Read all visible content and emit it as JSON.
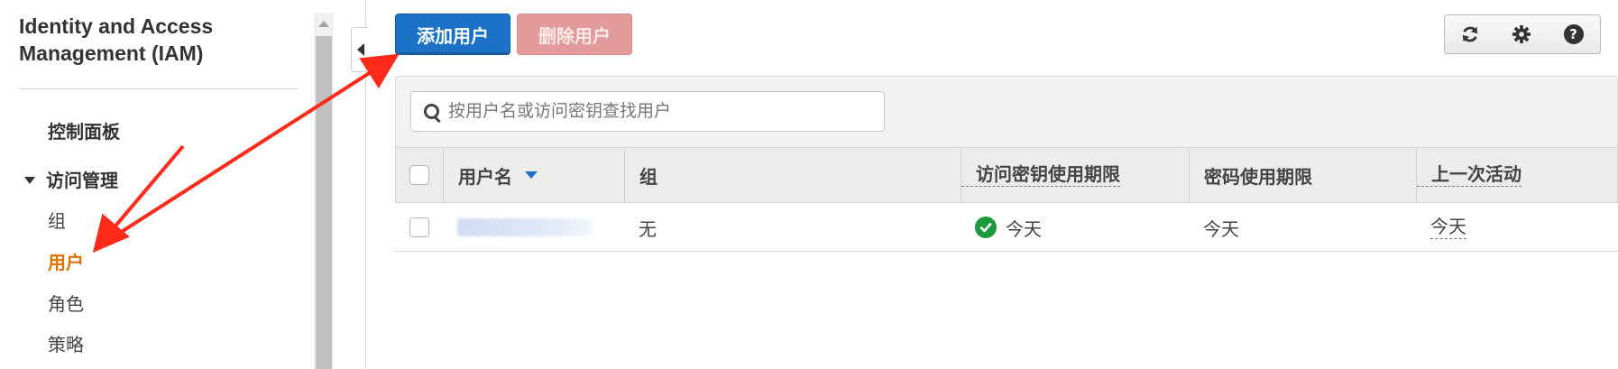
{
  "sidebar": {
    "title": "Identity and Access Management (IAM)",
    "dashboard": "控制面板",
    "access_management": "访问管理",
    "items": [
      {
        "label": "组"
      },
      {
        "label": "用户"
      },
      {
        "label": "角色"
      },
      {
        "label": "策略"
      }
    ]
  },
  "toolbar": {
    "add_user": "添加用户",
    "delete_user": "删除用户",
    "help_glyph": "?"
  },
  "search": {
    "placeholder": "按用户名或访问密钥查找用户"
  },
  "table": {
    "columns": [
      "用户名",
      "组",
      "访问密钥使用期限",
      "密码使用期限",
      "上一次活动"
    ],
    "rows": [
      {
        "username": "",
        "groups": "无",
        "key_age": "今天",
        "password_age": "今天",
        "last_activity": "今天"
      }
    ]
  },
  "colors": {
    "primary": "#1c72c6",
    "danger_disabled": "#e39a9a",
    "active_nav": "#e07000",
    "success": "#1d9a3c",
    "annotation": "#ff2a1a"
  },
  "icons": {
    "refresh": "refresh-icon",
    "settings": "gear-icon",
    "help": "help-icon",
    "search": "search-icon",
    "key_ok": "check-circle-icon"
  }
}
